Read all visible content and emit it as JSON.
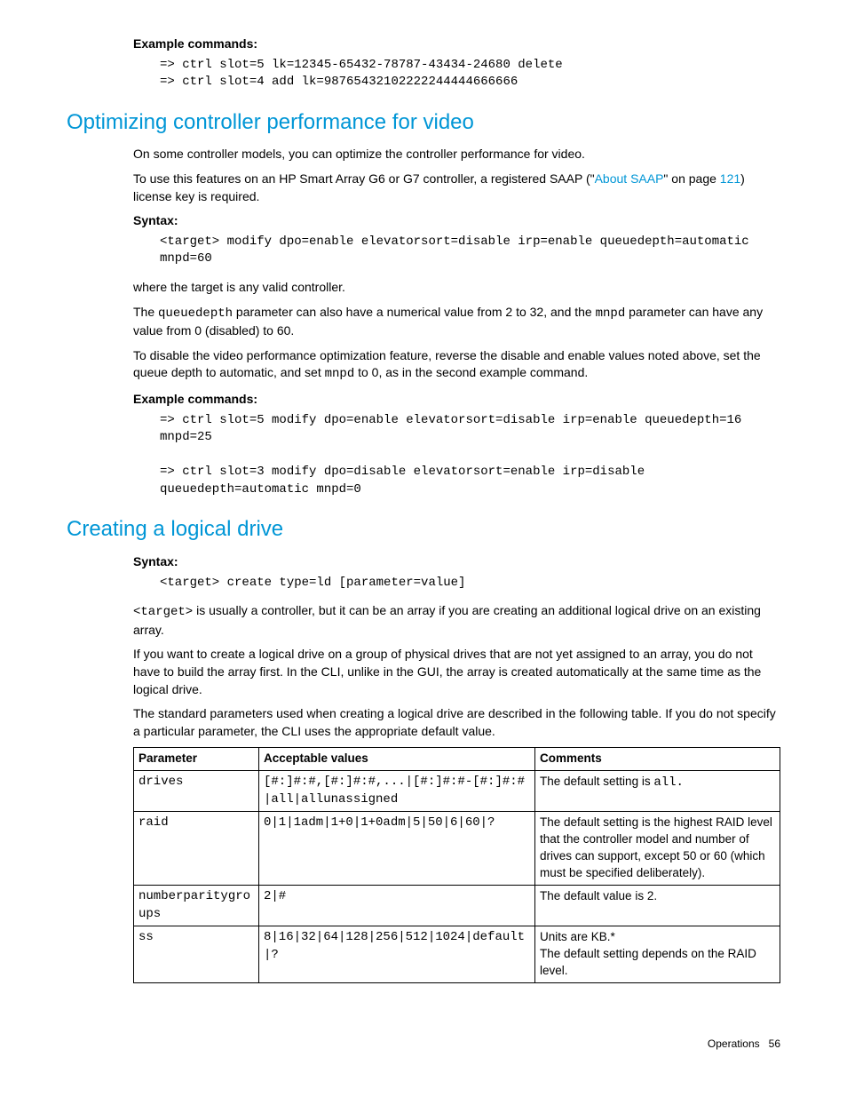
{
  "s1": {
    "h_example": "Example commands:",
    "cmd1": "=> ctrl slot=5 lk=12345-65432-78787-43434-24680 delete",
    "cmd2": "=> ctrl slot=4 add lk=98765432102222244444666666"
  },
  "s2": {
    "heading": "Optimizing controller performance for video",
    "p1": "On some controller models, you can optimize the controller performance for video.",
    "p2a": "To use this features on an HP Smart Array G6 or G7 controller, a registered SAAP (\"",
    "p2link1": "About SAAP",
    "p2b": "\" on page ",
    "p2link2": "121",
    "p2c": ") license key is required.",
    "h_syntax": "Syntax:",
    "syntax1": "<target> modify dpo=enable elevatorsort=disable irp=enable queuedepth=automatic mnpd=60",
    "p3": "where the target is any valid controller.",
    "p4a": "The ",
    "p4c1": "queuedepth",
    "p4b": " parameter can also have a numerical value from 2 to 32, and the ",
    "p4c2": "mnpd",
    "p4c": " parameter can have any value from 0 (disabled) to 60.",
    "p5a": "To disable the video performance optimization feature, reverse the disable and enable values noted above, set the queue depth to automatic, and set ",
    "p5c1": "mnpd",
    "p5b": " to 0, as in the second example command.",
    "h_example": "Example commands:",
    "ex1": "=> ctrl slot=5 modify dpo=enable elevatorsort=disable irp=enable queuedepth=16 mnpd=25",
    "ex2": "=> ctrl slot=3 modify dpo=disable elevatorsort=enable irp=disable queuedepth=automatic mnpd=0"
  },
  "s3": {
    "heading": "Creating a logical drive",
    "h_syntax": "Syntax:",
    "syntax1": "<target> create type=ld [parameter=value]",
    "p1a": "<target>",
    "p1b": " is usually a controller, but it can be an array if you are creating an additional logical drive on an existing array.",
    "p2": "If you want to create a logical drive on a group of physical drives that are not yet assigned to an array, you do not have to build the array first. In the CLI, unlike in the GUI, the array is created automatically at the same time as the logical drive.",
    "p3": "The standard parameters used when creating a logical drive are described in the following table. If you do not specify a particular parameter, the CLI uses the appropriate default value.",
    "th1": "Parameter",
    "th2": "Acceptable values",
    "th3": "Comments",
    "r1c1": "drives",
    "r1c2": "[#:]#:#,[#:]#:#,...|[#:]#:#-[#:]#:#|all|allunassigned",
    "r1c3a": "The default setting is ",
    "r1c3b": "all.",
    "r2c1": "raid",
    "r2c2": "0|1|1adm|1+0|1+0adm|5|50|6|60|?",
    "r2c3": "The default setting is the highest RAID level that the controller model and number of drives can support, except 50 or 60 (which must be specified deliberately).",
    "r3c1": "numberparitygroups",
    "r3c2": "2|#",
    "r3c3": "The default value is 2.",
    "r4c1": "ss",
    "r4c2": "8|16|32|64|128|256|512|1024|default|?",
    "r4c3": "Units are KB.*\nThe default setting depends on the RAID level."
  },
  "footer": {
    "label": "Operations",
    "page": "56"
  }
}
